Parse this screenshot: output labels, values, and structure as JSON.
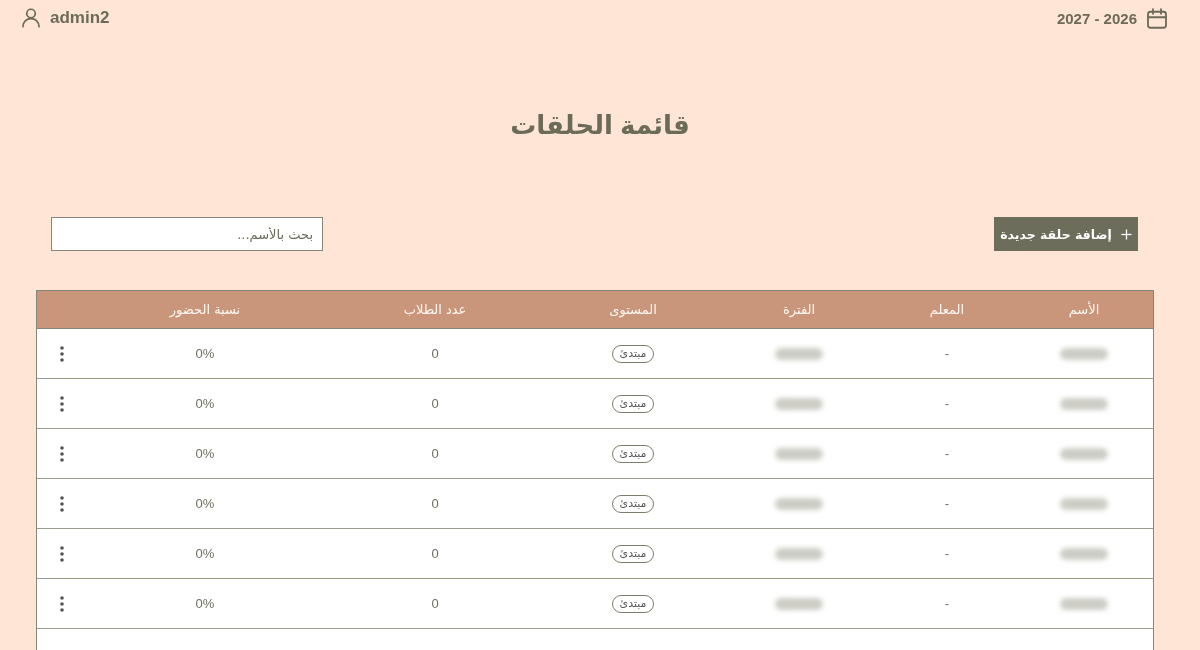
{
  "header": {
    "user": "admin2",
    "academic_year": "2027 - 2026"
  },
  "title": "قائمة الحلقات",
  "toolbar": {
    "add_button": "إضافة حلقة جديدة",
    "search": {
      "placeholder": "بحث بالأسم..."
    }
  },
  "table": {
    "columns": [
      "الأسم",
      "المعلم",
      "الفترة",
      "المستوى",
      "عدد الطلاب",
      "نسبة الحضور"
    ],
    "rows": [
      {
        "name_blurred": true,
        "teacher": "-",
        "period_blurred": true,
        "level": "مبتدئ",
        "students": "0",
        "attendance": "0%"
      },
      {
        "name_blurred": true,
        "teacher": "-",
        "period_blurred": true,
        "level": "مبتدئ",
        "students": "0",
        "attendance": "0%"
      },
      {
        "name_blurred": true,
        "teacher": "-",
        "period_blurred": true,
        "level": "مبتدئ",
        "students": "0",
        "attendance": "0%"
      },
      {
        "name_blurred": true,
        "teacher": "-",
        "period_blurred": true,
        "level": "مبتدئ",
        "students": "0",
        "attendance": "0%"
      },
      {
        "name_blurred": true,
        "teacher": "-",
        "period_blurred": true,
        "level": "مبتدئ",
        "students": "0",
        "attendance": "0%"
      },
      {
        "name_blurred": true,
        "teacher": "-",
        "period_blurred": true,
        "level": "مبتدئ",
        "students": "0",
        "attendance": "0%"
      }
    ]
  }
}
